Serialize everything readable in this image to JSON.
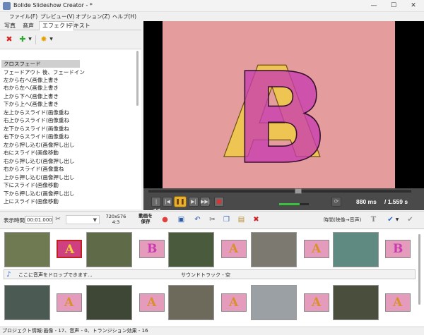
{
  "window": {
    "title": "Bolide Slideshow Creator - *",
    "minimize": "—",
    "maximize": "☐",
    "close": "✕"
  },
  "menu": [
    "ファイル(F)",
    "プレビュー(V)",
    "オプション(Z)",
    "ヘルプ(H)"
  ],
  "tabs": [
    "写真",
    "音声",
    "エフェクト",
    "テキスト"
  ],
  "active_tab": "エフェクト",
  "effect_toolbar": {
    "delete": "✖",
    "add": "✚",
    "auto": "✸"
  },
  "effects": [
    "クロスフェード",
    "フェードアウト 後、フェードイン",
    "左から右へ(画像上書き",
    "右から左へ(画像上書き",
    "上から下へ(画像上書き",
    "下から上へ(画像上書き",
    "左上からスライド(画像重ね",
    "右上からスライド(画像重ね",
    "左下からスライド(画像重ね",
    "右下からスライド(画像重ね",
    "左から押し込む(画像押し出し",
    "右にスライド(画像移動",
    "右から押し込む(画像押し出し",
    "右からスライド(画像重ね",
    "上から押し込む(画像押し出し",
    "下にスライド(画像移動",
    "下から押し込む(画像押し出し",
    "上にスライド(画像移動"
  ],
  "selected_effect": "クロスフェード",
  "preview": {
    "glyph": "B",
    "glyph_2": "A",
    "bg_color": "#e59c9c",
    "letter_color_1": "#c83cb0",
    "letter_color_2": "#f0d040"
  },
  "player": {
    "time_current": "880 ms",
    "time_total": "/ 1.559 s",
    "seek_progress": 0.57,
    "volume": 0.7,
    "buttons": [
      "|◀◀",
      "|◀",
      "❚❚",
      "▶|",
      "▶▶|"
    ]
  },
  "bottom_toolbar": {
    "duration_label": "表示時間",
    "duration_value": "00:01.000",
    "size_line1": "720x576",
    "size_line2": "4:3",
    "save_line1": "動画を",
    "save_line2": "保存",
    "mode_label": "時間(映像→音声)"
  },
  "timeline": {
    "sound_drop": "ここに音声をドロップできます...",
    "sound_track": "サウンドトラック - 空",
    "transition_letters": [
      "A",
      "B",
      "A",
      "A",
      "B",
      "A",
      "A",
      "A",
      "A",
      "A"
    ],
    "photo_colors": [
      "#6f7a52",
      "#5f6b48",
      "#4a5a3c",
      "#7c7a70",
      "#5e8a82",
      "#4b5a52",
      "#3e4636",
      "#6d6a5c",
      "#9aa0a4",
      "#4a4e3c"
    ]
  },
  "status": "プロジェクト情報:画像 - 17、音声 - 0、トランジション効果 - 16"
}
